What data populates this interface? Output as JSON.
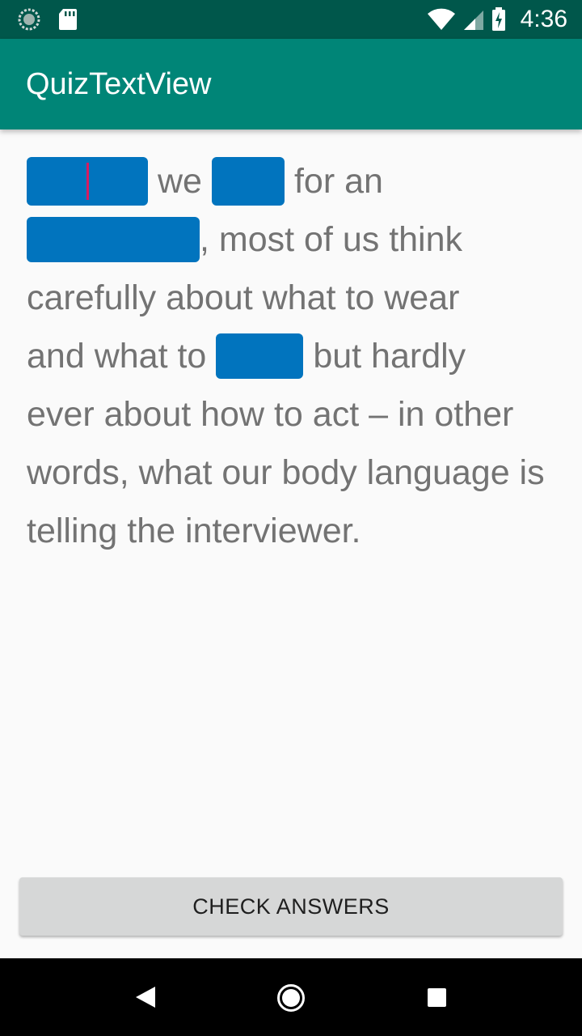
{
  "status_bar": {
    "time": "4:36",
    "icons": [
      "sync-icon",
      "sd-card-icon",
      "wifi-icon",
      "cell-signal-icon",
      "battery-charging-icon"
    ]
  },
  "app_bar": {
    "title": "QuizTextView"
  },
  "quiz": {
    "line1": {
      "t1": "we",
      "t2": "for an"
    },
    "line2": {
      "t1": ", most of us think"
    },
    "line3": {
      "t1": "carefully about what to wear"
    },
    "line4": {
      "t1": "and what to",
      "t2": "but hardly"
    },
    "line5": {
      "t1": "ever about how to act – in other"
    },
    "line6": {
      "t1": "words, what our body language is"
    },
    "line7": {
      "t1": "telling the interviewer."
    },
    "blank_color": "#0174be",
    "cursor_color": "#d81b60"
  },
  "check_button": {
    "label": "CHECK ANSWERS"
  },
  "nav_bar": {
    "icons": [
      "back-icon",
      "home-icon",
      "recents-icon"
    ]
  },
  "colors": {
    "status_bar": "#00574b",
    "app_bar": "#008577",
    "text": "#737373",
    "background": "#fafafa"
  }
}
